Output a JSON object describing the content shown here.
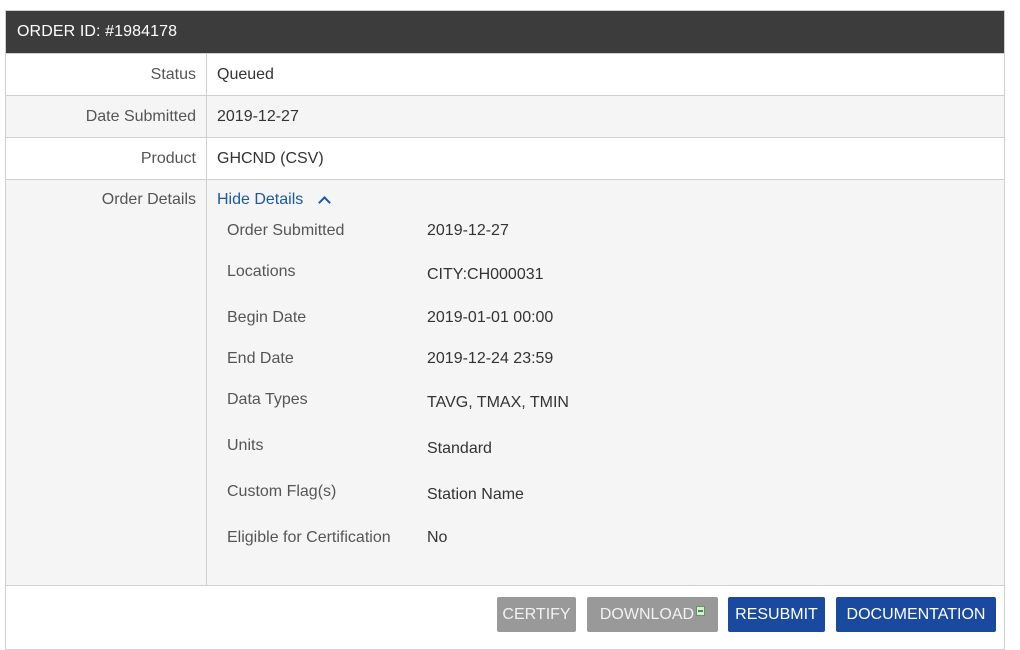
{
  "order": {
    "title": "ORDER ID: #1984178"
  },
  "rows": {
    "status": {
      "label": "Status",
      "value": "Queued"
    },
    "date_submitted": {
      "label": "Date Submitted",
      "value": "2019-12-27"
    },
    "product": {
      "label": "Product",
      "value": "GHCND (CSV)"
    },
    "order_details": {
      "label": "Order Details",
      "toggle": "Hide Details"
    }
  },
  "details": [
    {
      "label": "Order Submitted",
      "value": "2019-12-27"
    },
    {
      "label": "Locations",
      "value": "CITY:CH000031"
    },
    {
      "label": "Begin Date",
      "value": "2019-01-01 00:00"
    },
    {
      "label": "End Date",
      "value": "2019-12-24 23:59"
    },
    {
      "label": "Data Types",
      "value": "TAVG, TMAX, TMIN"
    },
    {
      "label": "Units",
      "value": "Standard"
    },
    {
      "label": "Custom Flag(s)",
      "value": "Station Name"
    },
    {
      "label": "Eligible for Certification",
      "value": "No"
    }
  ],
  "buttons": {
    "certify": "CERTIFY",
    "download": "DOWNLOAD",
    "resubmit": "RESUBMIT",
    "documentation": "DOCUMENTATION"
  },
  "icons": {
    "chevron": "chevron-up-icon",
    "download": "spreadsheet-icon"
  },
  "colors": {
    "header_bg": "#3c3c3c",
    "link": "#1a5aa1",
    "primary_button": "#1a4aa0",
    "disabled_button": "#999999"
  }
}
